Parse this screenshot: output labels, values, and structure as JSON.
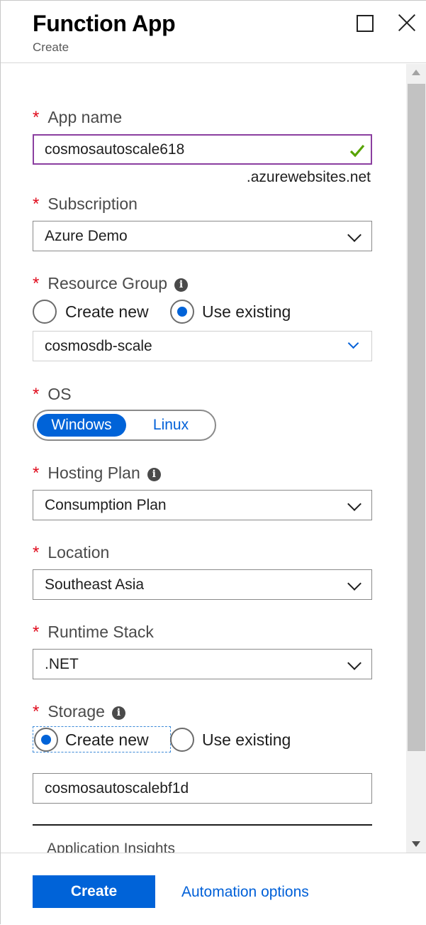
{
  "header": {
    "title": "Function App",
    "subtitle": "Create"
  },
  "form": {
    "app_name": {
      "label": "App name",
      "value": "cosmosautoscale618",
      "suffix": ".azurewebsites.net"
    },
    "subscription": {
      "label": "Subscription",
      "value": "Azure Demo"
    },
    "resource_group": {
      "label": "Resource Group",
      "option_create_new": "Create new",
      "option_use_existing": "Use existing",
      "selected": "Use existing",
      "value": "cosmosdb-scale"
    },
    "os": {
      "label": "OS",
      "options": [
        "Windows",
        "Linux"
      ],
      "selected": "Windows"
    },
    "hosting_plan": {
      "label": "Hosting Plan",
      "value": "Consumption Plan"
    },
    "location": {
      "label": "Location",
      "value": "Southeast Asia"
    },
    "runtime_stack": {
      "label": "Runtime Stack",
      "value": ".NET"
    },
    "storage": {
      "label": "Storage",
      "option_create_new": "Create new",
      "option_use_existing": "Use existing",
      "selected": "Create new",
      "value": "cosmosautoscalebf1d"
    },
    "application_insights": {
      "label": "Application Insights"
    },
    "required_mark": "*",
    "info_glyph": "i"
  },
  "footer": {
    "create_label": "Create",
    "automation_label": "Automation options"
  },
  "colors": {
    "accent": "#0063d8",
    "required": "#e00b1c",
    "valid": "#57a300",
    "focus_border": "#8b3fa0"
  }
}
